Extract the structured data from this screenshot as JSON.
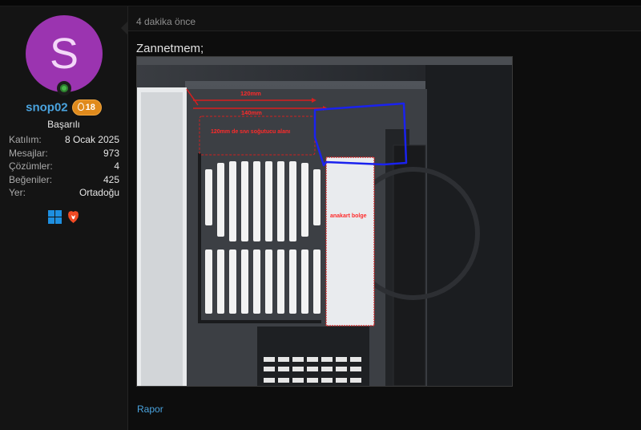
{
  "user": {
    "avatar_letter": "S",
    "username": "snop02",
    "rank_points": "18",
    "title": "Başarılı",
    "online": true,
    "stats": [
      {
        "label": "Katılım:",
        "value": "8 Ocak 2025"
      },
      {
        "label": "Mesajlar:",
        "value": "973"
      },
      {
        "label": "Çözümler:",
        "value": "4"
      },
      {
        "label": "Beğeniler:",
        "value": "425"
      },
      {
        "label": "Yer:",
        "value": "Ortadoğu"
      }
    ],
    "os_icons": [
      "windows-icon",
      "brave-browser-icon"
    ]
  },
  "post": {
    "time": "4 dakika önce",
    "text": "Zannetmem;",
    "image_annotations": {
      "label_120mm": "120mm",
      "label_140mm": "140mm",
      "radiator_area": "120mm de sıvı soğutucu alanı",
      "motherboard_area": "anakart bolge"
    },
    "report_label": "Rapor"
  },
  "colors": {
    "accent": "#4aa3de",
    "avatar": "#9b34b0",
    "badge": "#e08a1c",
    "online": "#49b54a"
  }
}
